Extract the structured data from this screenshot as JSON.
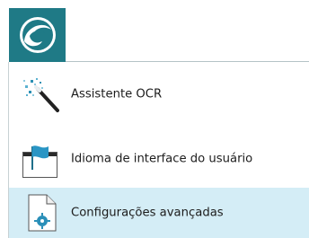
{
  "app_button": {
    "icon": "wave-logo-icon",
    "color": "#1f7a86"
  },
  "menu": {
    "items": [
      {
        "label": "Assistente OCR",
        "icon": "magic-wand-icon"
      },
      {
        "label": "Idioma de interface do usuário",
        "icon": "flag-window-icon"
      },
      {
        "label": "Configurações avançadas",
        "icon": "settings-document-icon",
        "selected": true
      }
    ]
  },
  "colors": {
    "accent": "#1f7a86",
    "selection": "#d4edf6"
  }
}
